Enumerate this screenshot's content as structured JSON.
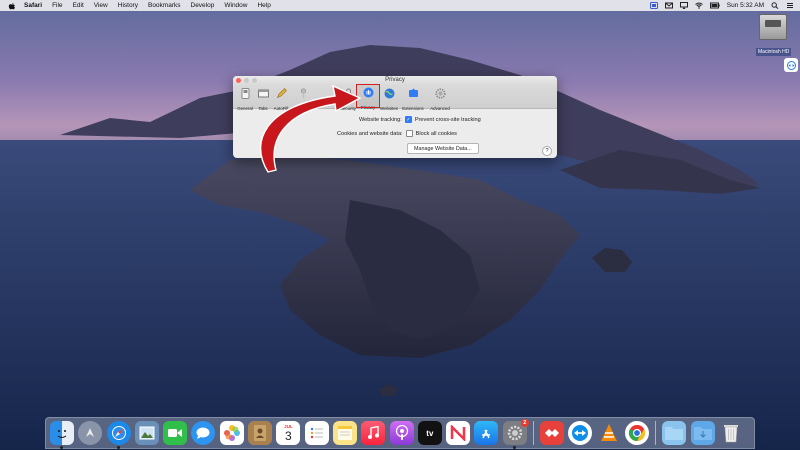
{
  "menubar": {
    "app": "Safari",
    "items": [
      "File",
      "Edit",
      "View",
      "History",
      "Bookmarks",
      "Develop",
      "Window",
      "Help"
    ],
    "clock": "Sun 5:32 AM"
  },
  "desktop": {
    "drive_label": "Macintosh HD"
  },
  "prefs_window": {
    "title": "Privacy",
    "tabs": [
      {
        "label": "General",
        "icon": "general-switch-icon"
      },
      {
        "label": "Tabs",
        "icon": "tabs-icon"
      },
      {
        "label": "AutoFill",
        "icon": "pencil-icon"
      },
      {
        "label": "Pa",
        "icon": "key-icon"
      },
      {
        "label": "Security",
        "icon": "lock-icon"
      },
      {
        "label": "Privacy",
        "icon": "hand-icon"
      },
      {
        "label": "Websites",
        "icon": "globe-icon"
      },
      {
        "label": "Extensions",
        "icon": "puzzle-icon"
      },
      {
        "label": "Advanced",
        "icon": "gear-icon"
      }
    ],
    "selected_tab": "Privacy",
    "website_tracking_label": "Website tracking:",
    "prevent_tracking_label": "Prevent cross-site tracking",
    "prevent_tracking_checked": true,
    "cookies_label": "Cookies and website data:",
    "block_cookies_label": "Block all cookies",
    "block_cookies_checked": false,
    "manage_button": "Manage Website Data...",
    "help": "?"
  },
  "dock": {
    "calendar_day": "3",
    "calendar_month": "JUL",
    "appletv_label": "tv",
    "sysprefs_badge": "2"
  },
  "colors": {
    "accent_blue": "#2f7cf6",
    "highlight_red": "#d21f1f"
  }
}
